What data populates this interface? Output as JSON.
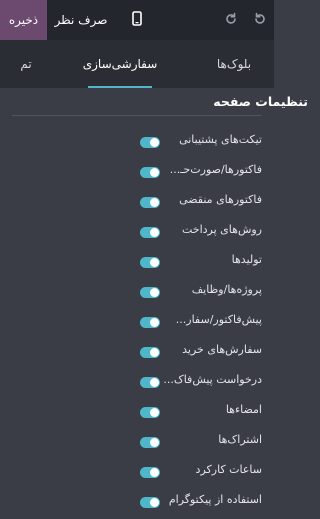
{
  "toolbar": {
    "save_label": "ذخیره",
    "discard_label": "صرف نظر",
    "accent_color": "#6c4a6f"
  },
  "tabs": [
    {
      "label": "بلوک‌ها",
      "active": false
    },
    {
      "label": "سفارشی‌سازی",
      "active": true
    },
    {
      "label": "تم",
      "active": false
    }
  ],
  "section": {
    "title": "تنظیمات صفحه"
  },
  "options": [
    {
      "label": "تیکت‌های پشتیبانی",
      "enabled": true
    },
    {
      "label": "فاکتورها/صورت‌حـ...",
      "enabled": true
    },
    {
      "label": "فاکتورهای منقضی",
      "enabled": true
    },
    {
      "label": "روش‌های پرداخت",
      "enabled": true
    },
    {
      "label": "تولیدها",
      "enabled": true
    },
    {
      "label": "پروژه‌ها/وظایف",
      "enabled": true
    },
    {
      "label": "پیش‌فاکتور/سفار...",
      "enabled": true
    },
    {
      "label": "سفارش‌های خرید",
      "enabled": true
    },
    {
      "label": "درخواست پیش‌فاک...",
      "enabled": true
    },
    {
      "label": "امضاءها",
      "enabled": true
    },
    {
      "label": "اشتراک‌ها",
      "enabled": true
    },
    {
      "label": "ساعات کارکرد",
      "enabled": true
    },
    {
      "label": "استفاده از پیکتوگرام",
      "enabled": true
    }
  ],
  "icons": {
    "mobile": "mobile-preview-icon",
    "redo": "redo-icon",
    "undo": "undo-icon"
  },
  "colors": {
    "toggle_on": "#4fb7c9",
    "panel_bg": "#3a3d46",
    "topbar_bg": "#24262d"
  }
}
